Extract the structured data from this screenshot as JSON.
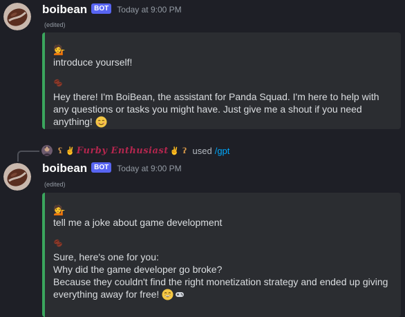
{
  "messages": [
    {
      "username": "boibean",
      "bot_tag": "BOT",
      "timestamp": "Today at 9:00 PM",
      "edited": "(edited)",
      "user_emoji": "💁",
      "prompt": "introduce yourself!",
      "bot_emoji": "☕",
      "reply": "Hey there! I'm BoiBean, the assistant for Panda Squad. I'm here to help with any questions or tasks you might have. Just give me a shout if you need anything!",
      "reply_end_emoji": "smiling-face-icon"
    },
    {
      "command_user": "𝑭𝒖𝒓𝒃𝒚 𝑬𝒏𝒕𝒉𝒖𝒔𝒊𝒂𝒔𝒕",
      "command_used": "used",
      "command_name": "/gpt",
      "username": "boibean",
      "bot_tag": "BOT",
      "timestamp": "Today at 9:00 PM",
      "edited": "(edited)",
      "user_emoji": "💁",
      "prompt": "tell me a joke about game development",
      "bot_emoji": "☕",
      "reply_lines": [
        "Sure, here's one for you:",
        "Why did the game developer go broke?",
        "Because they couldn't find the right monetization strategy and ended up giving",
        "everything away for free!"
      ],
      "reply_end_emoji": "grinning-face-icon"
    }
  ],
  "colors": {
    "background": "#1e1f26",
    "embed_background": "#2b2d31",
    "embed_border": "#3ba55d",
    "bot_tag": "#5865f2",
    "command_link": "#00a8fc",
    "command_user": "#b3264e"
  }
}
